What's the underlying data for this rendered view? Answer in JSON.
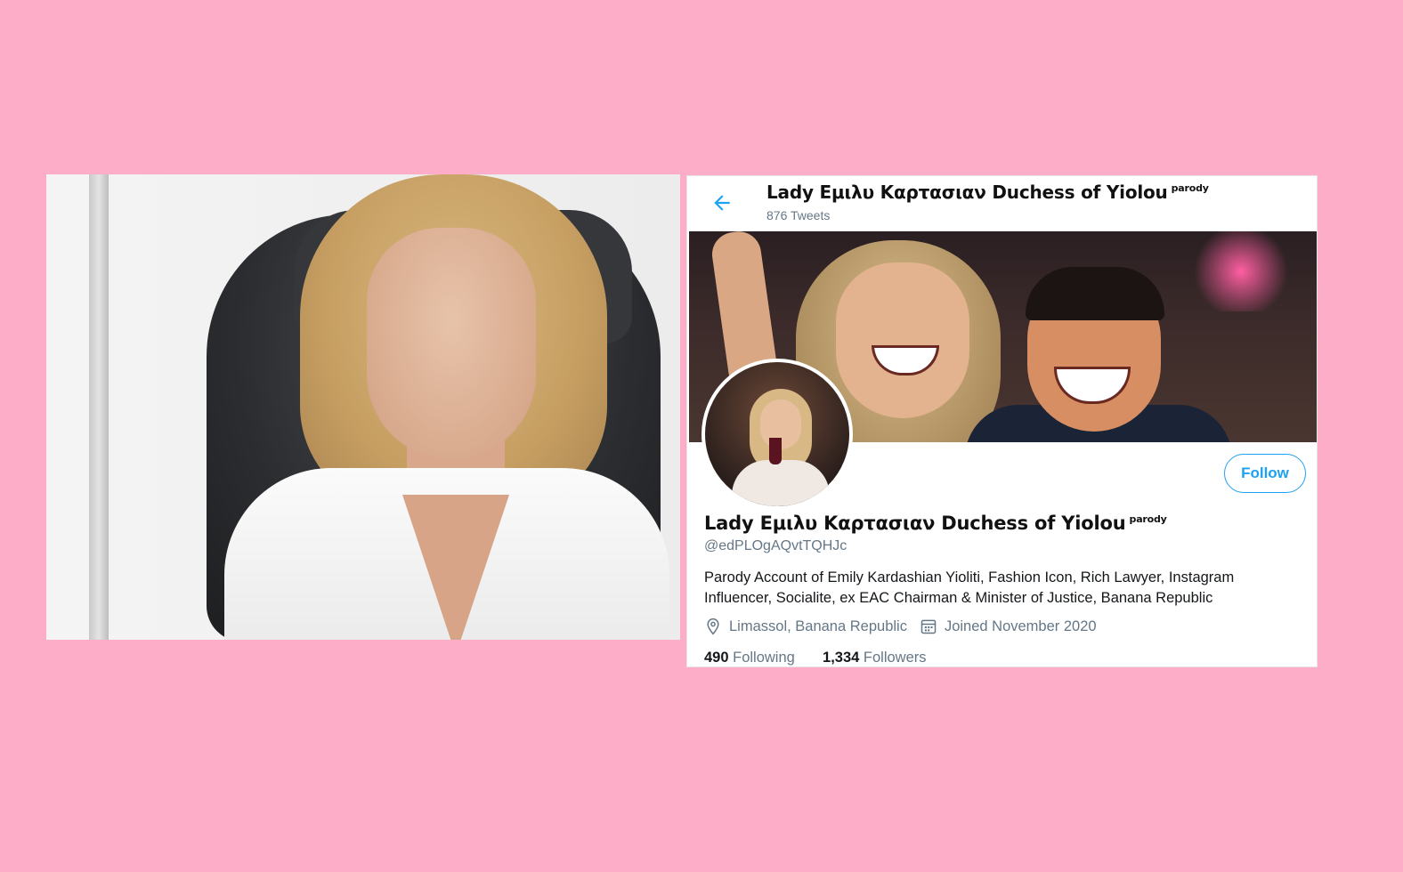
{
  "profile": {
    "display_name": "Lady Εμιλυ Καρτασιαν Duchess of Yiolou",
    "parody_tag": "parody",
    "tweet_count": "876 Tweets",
    "handle": "@edPLOgAQvtTQHJc",
    "bio": "Parody Account of Emily Kardashian Yioliti, Fashion Icon, Rich Lawyer, Instagram Influencer, Socialite,  ex EAC Chairman & Minister of Justice, Banana Republic",
    "location": "Limassol, Banana Republic",
    "joined": "Joined November 2020",
    "following_count": "490",
    "following_label": "Following",
    "followers_count": "1,334",
    "followers_label": "Followers",
    "follow_button": "Follow"
  },
  "icons": {
    "back": "arrow-left-icon",
    "location": "map-pin-icon",
    "calendar": "calendar-icon"
  },
  "colors": {
    "background": "#fdadc8",
    "accent": "#1da1f2",
    "secondary_text": "#657786"
  }
}
